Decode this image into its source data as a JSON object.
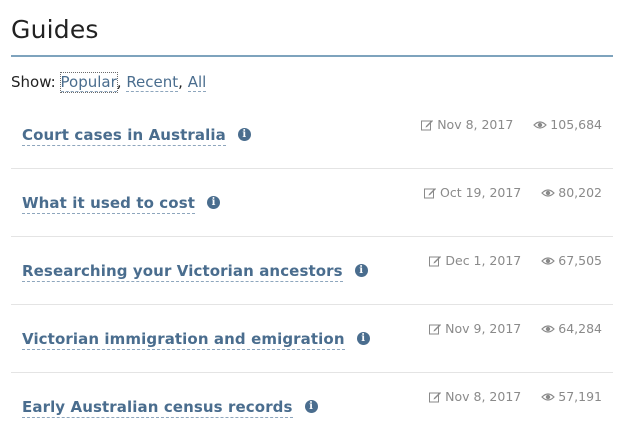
{
  "page": {
    "title": "Guides"
  },
  "filter": {
    "label": "Show:",
    "options": [
      {
        "label": "Popular",
        "active": true
      },
      {
        "label": "Recent",
        "active": false
      },
      {
        "label": "All",
        "active": false
      }
    ],
    "separator": ","
  },
  "guides": [
    {
      "title": "Court cases in Australia",
      "date": "Nov 8, 2017",
      "views": "105,684"
    },
    {
      "title": "What it used to cost",
      "date": "Oct 19, 2017",
      "views": "80,202"
    },
    {
      "title": "Researching your Victorian ancestors",
      "date": "Dec 1, 2017",
      "views": "67,505"
    },
    {
      "title": "Victorian immigration and emigration",
      "date": "Nov 9, 2017",
      "views": "64,284"
    },
    {
      "title": "Early Australian census records",
      "date": "Nov 8, 2017",
      "views": "57,191"
    }
  ],
  "icons": {
    "info": "info-icon",
    "edit": "edit-icon",
    "views": "eye-icon"
  },
  "colors": {
    "link": "#4a6d8e",
    "rule": "#7ea3bd",
    "meta": "#8a8a8a"
  }
}
